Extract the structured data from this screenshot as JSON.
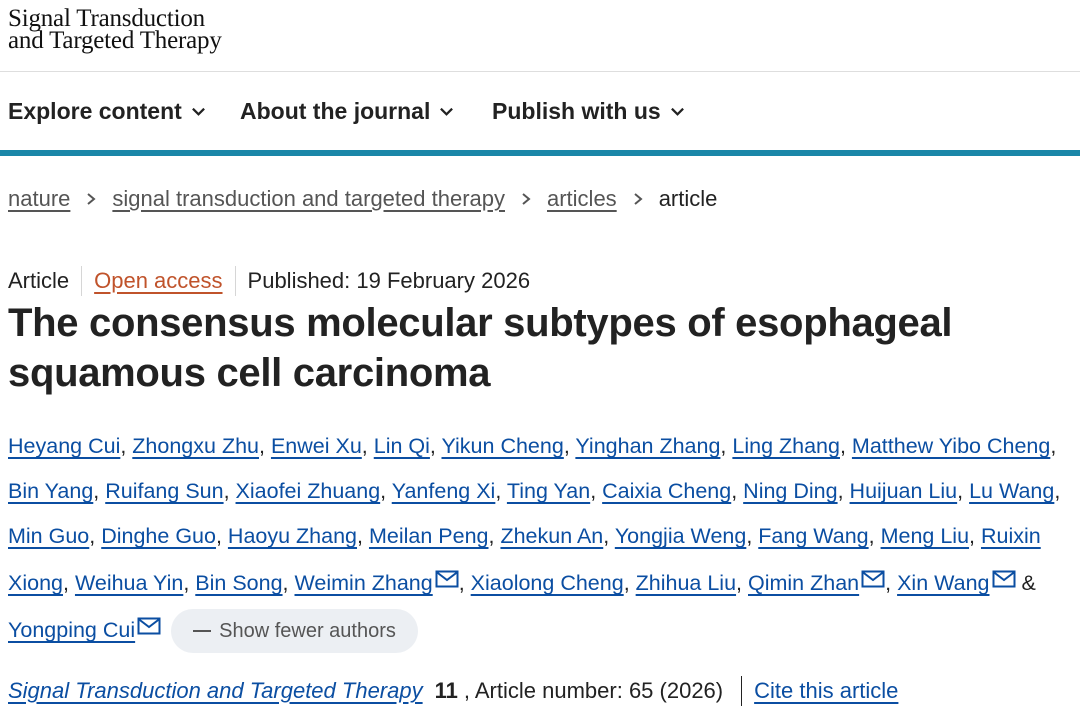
{
  "site": {
    "logo_line1": "Signal Transduction",
    "logo_line2": "and Targeted Therapy"
  },
  "nav": {
    "items": [
      {
        "label": "Explore content"
      },
      {
        "label": "About the journal"
      },
      {
        "label": "Publish with us"
      }
    ],
    "accent_color": "#1a87a8"
  },
  "breadcrumb": {
    "items": [
      "nature",
      "signal transduction and targeted therapy",
      "articles"
    ],
    "current": "article"
  },
  "article": {
    "type": "Article",
    "access": "Open access",
    "published": "Published: 19 February 2026",
    "title": "The consensus molecular subtypes of esophageal squamous cell carcinoma",
    "authors": [
      "Heyang Cui",
      "Zhongxu Zhu",
      "Enwei Xu",
      "Lin Qi",
      "Yikun Cheng",
      "Yinghan Zhang",
      "Ling Zhang",
      "Matthew Yibo Cheng",
      "Bin Yang",
      "Ruifang Sun",
      "Xiaofei Zhuang",
      "Yanfeng Xi",
      "Ting Yan",
      "Caixia Cheng",
      "Ning Ding",
      "Huijuan Liu",
      "Lu Wang",
      "Min Guo",
      "Dinghe Guo",
      "Haoyu Zhang",
      "Meilan Peng",
      "Zhekun An",
      "Yongjia Weng",
      "Fang Wang",
      "Meng Liu",
      "Ruixin Xiong",
      "Weihua Yin",
      "Bin Song",
      "Weimin Zhang",
      "Xiaolong Cheng",
      "Zhihua Liu",
      "Qimin Zhan",
      "Xin Wang",
      "Yongping Cui"
    ],
    "corresponding": [
      "Weimin Zhang",
      "Qimin Zhan",
      "Xin Wang",
      "Yongping Cui"
    ],
    "amp": "&",
    "show_fewer_label": "Show fewer authors",
    "journal": "Signal Transduction and Targeted Therapy",
    "volume": "11",
    "article_number": ", Article number: 65 (2026)",
    "cite_label": "Cite this article"
  },
  "colors": {
    "link": "#0b4ea2",
    "open_access": "#c0532b",
    "text": "#222222"
  },
  "icons": {
    "nav_chevron": "chevron-down-icon",
    "breadcrumb_separator": "chevron-right-icon",
    "corresponding": "envelope-icon",
    "collapse": "minus-icon"
  }
}
